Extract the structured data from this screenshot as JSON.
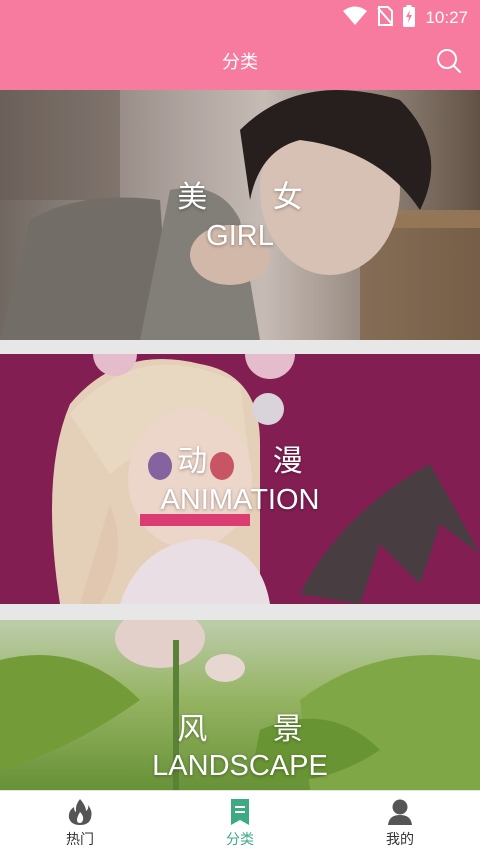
{
  "status_bar": {
    "time": "10:27",
    "icons": [
      "wifi-icon",
      "no-sim-icon",
      "battery-charging-icon"
    ]
  },
  "app_bar": {
    "title": "分类",
    "search_icon": "search-icon"
  },
  "categories": [
    {
      "title_cn": "美 女",
      "title_en": "GIRL"
    },
    {
      "title_cn": "动 漫",
      "title_en": "ANIMATION"
    },
    {
      "title_cn": "风 景",
      "title_en": "LANDSCAPE"
    }
  ],
  "bottom_nav": {
    "items": [
      {
        "label": "热门",
        "icon": "fire-icon",
        "active": false
      },
      {
        "label": "分类",
        "icon": "bookmark-list-icon",
        "active": true
      },
      {
        "label": "我的",
        "icon": "person-icon",
        "active": false
      }
    ]
  },
  "colors": {
    "primary": "#f77a9f",
    "active_tab": "#3daa84",
    "anime_background": "#8c2059"
  }
}
